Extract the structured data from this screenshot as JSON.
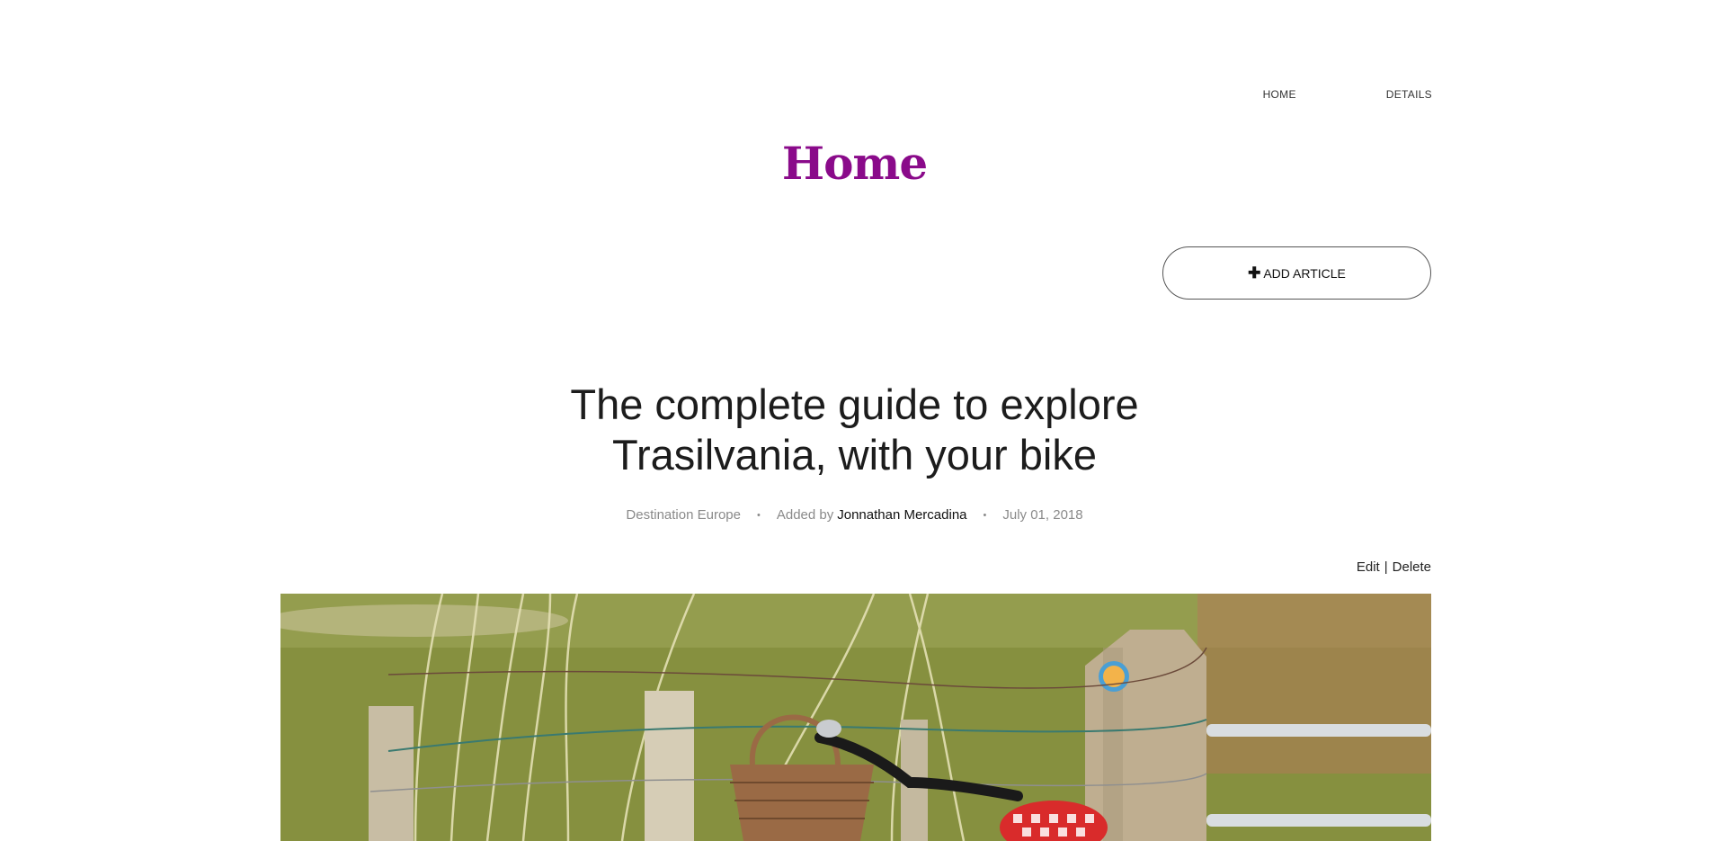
{
  "nav": {
    "items": [
      {
        "label": "HOME"
      },
      {
        "label": "DETAILS"
      }
    ]
  },
  "site": {
    "title": "Home"
  },
  "add_article": {
    "icon": "plus-icon",
    "label": "ADD ARTICLE"
  },
  "article": {
    "title_line1": "The complete guide to explore",
    "title_line2": "Trasilvania, with your bike",
    "category": "Destination Europe",
    "added_by_label": "Added by",
    "author": "Jonnathan Mercadina",
    "date": "July 01, 2018",
    "separator": "•",
    "actions": {
      "edit": "Edit",
      "divider": "|",
      "delete": "Delete"
    },
    "image_subject": "bicycle with wicker basket leaning on wooden fence in a field"
  },
  "colors": {
    "brand": "#8a0a8a",
    "text": "#1c1c1c",
    "muted": "#8a8a8a"
  }
}
